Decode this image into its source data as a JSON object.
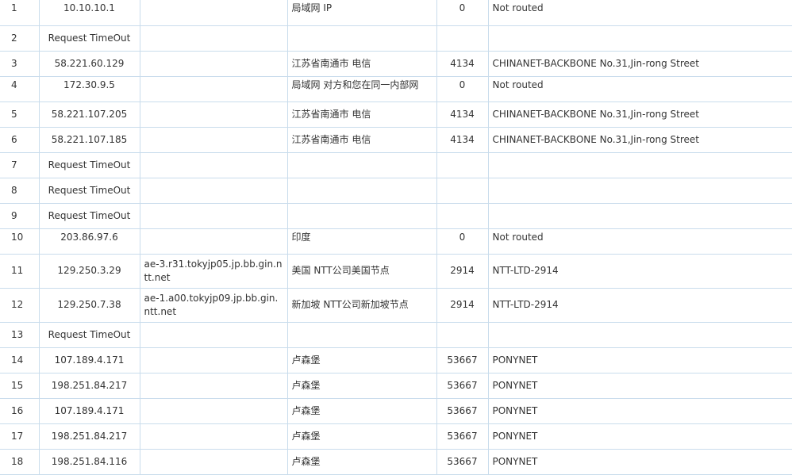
{
  "rows": [
    {
      "hop": "1",
      "ip": "10.10.10.1",
      "host": "",
      "location": "局域网 IP",
      "asn": "0",
      "network": "Not routed"
    },
    {
      "hop": "2",
      "ip": "Request TimeOut",
      "host": "",
      "location": "",
      "asn": "",
      "network": ""
    },
    {
      "hop": "3",
      "ip": "58.221.60.129",
      "host": "",
      "location": "江苏省南通市 电信",
      "asn": "4134",
      "network": "CHINANET-BACKBONE No.31,Jin-rong Street"
    },
    {
      "hop": "4",
      "ip": "172.30.9.5",
      "host": "",
      "location": "局域网 对方和您在同一内部网",
      "asn": "0",
      "network": "Not routed"
    },
    {
      "hop": "5",
      "ip": "58.221.107.205",
      "host": "",
      "location": "江苏省南通市 电信",
      "asn": "4134",
      "network": "CHINANET-BACKBONE No.31,Jin-rong Street"
    },
    {
      "hop": "6",
      "ip": "58.221.107.185",
      "host": "",
      "location": "江苏省南通市 电信",
      "asn": "4134",
      "network": "CHINANET-BACKBONE No.31,Jin-rong Street"
    },
    {
      "hop": "7",
      "ip": "Request TimeOut",
      "host": "",
      "location": "",
      "asn": "",
      "network": ""
    },
    {
      "hop": "8",
      "ip": "Request TimeOut",
      "host": "",
      "location": "",
      "asn": "",
      "network": ""
    },
    {
      "hop": "9",
      "ip": "Request TimeOut",
      "host": "",
      "location": "",
      "asn": "",
      "network": ""
    },
    {
      "hop": "10",
      "ip": "203.86.97.6",
      "host": "",
      "location": "印度",
      "asn": "0",
      "network": "Not routed"
    },
    {
      "hop": "11",
      "ip": "129.250.3.29",
      "host": "ae-3.r31.tokyjp05.jp.bb.gin.ntt.net",
      "location": "美国 NTT公司美国节点",
      "asn": "2914",
      "network": "NTT-LTD-2914"
    },
    {
      "hop": "12",
      "ip": "129.250.7.38",
      "host": "ae-1.a00.tokyjp09.jp.bb.gin.ntt.net",
      "location": "新加坡 NTT公司新加坡节点",
      "asn": "2914",
      "network": "NTT-LTD-2914"
    },
    {
      "hop": "13",
      "ip": "Request TimeOut",
      "host": "",
      "location": "",
      "asn": "",
      "network": ""
    },
    {
      "hop": "14",
      "ip": "107.189.4.171",
      "host": "",
      "location": "卢森堡",
      "asn": "53667",
      "network": "PONYNET"
    },
    {
      "hop": "15",
      "ip": "198.251.84.217",
      "host": "",
      "location": "卢森堡",
      "asn": "53667",
      "network": "PONYNET"
    },
    {
      "hop": "16",
      "ip": "107.189.4.171",
      "host": "",
      "location": "卢森堡",
      "asn": "53667",
      "network": "PONYNET"
    },
    {
      "hop": "17",
      "ip": "198.251.84.217",
      "host": "",
      "location": "卢森堡",
      "asn": "53667",
      "network": "PONYNET"
    },
    {
      "hop": "18",
      "ip": "198.251.84.116",
      "host": "",
      "location": "卢森堡",
      "asn": "53667",
      "network": "PONYNET"
    }
  ],
  "colors": {
    "border": "#c9dcec",
    "text": "#333333"
  }
}
